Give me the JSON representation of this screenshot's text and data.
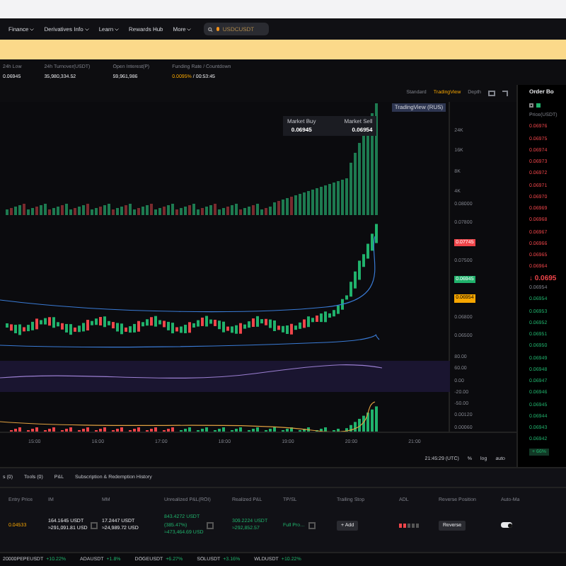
{
  "nav": {
    "items": [
      {
        "label": "Finance",
        "dropdown": true
      },
      {
        "label": "Derivatives Info",
        "dropdown": true
      },
      {
        "label": "Learn",
        "dropdown": true
      },
      {
        "label": "Rewards Hub",
        "dropdown": false
      },
      {
        "label": "More",
        "dropdown": true
      }
    ],
    "search": {
      "placeholder": "USDCUSDT"
    }
  },
  "stats": [
    {
      "label": "24h Low",
      "value": "0.06945",
      "highlight": false
    },
    {
      "label": "24h Turnover(USDT)",
      "value": "35,980,334.52",
      "highlight": false
    },
    {
      "label": "Open Interest(P)",
      "value": "59,961,986",
      "highlight": false
    },
    {
      "label": "Funding Rate / Countdown",
      "value": "0.0095%",
      "extra": "/ 00:53:45",
      "highlight": true
    }
  ],
  "chart": {
    "views": [
      {
        "label": "Standard",
        "selected": false
      },
      {
        "label": "TradingView",
        "selected": true
      },
      {
        "label": "Depth",
        "selected": false
      }
    ],
    "tv_badge": "TradingView (RUS)",
    "market_buy": {
      "label": "Market Buy",
      "price": "0.06945"
    },
    "market_sell": {
      "label": "Market Sell",
      "price": "0.06954"
    },
    "volume_labels": [
      "24K",
      "16K",
      "8K",
      "4K"
    ],
    "price_labels": [
      {
        "text": "0.08000",
        "kind": "plain"
      },
      {
        "text": "0.07800",
        "kind": "plain"
      },
      {
        "text": "0.07745",
        "kind": "sell"
      },
      {
        "text": "0.07500",
        "kind": "plain"
      },
      {
        "text": "0.06945",
        "kind": "buy"
      },
      {
        "text": "0.06954",
        "kind": "mark"
      },
      {
        "text": "0.06800",
        "kind": "plain"
      },
      {
        "text": "0.06500",
        "kind": "plain"
      }
    ],
    "osc_labels": [
      "80.00",
      "60.00",
      "0.00",
      "-20.00",
      "-50.00",
      "0.00120",
      "0.00060"
    ],
    "time_labels": [
      "15:00",
      "16:00",
      "17:00",
      "18:00",
      "19:00",
      "20:00",
      "21:00"
    ],
    "clock": "21:45:29 (UTC)",
    "options": [
      "%",
      "log",
      "auto"
    ]
  },
  "order_book": {
    "title": "Order Bo",
    "header": "Price(USDT)",
    "asks": [
      "0.06976",
      "0.06975",
      "0.06974",
      "0.06973",
      "0.06972",
      "0.06971",
      "0.06970",
      "0.06969",
      "0.06968",
      "0.06967",
      "0.06966",
      "0.06965",
      "0.06964"
    ],
    "last_price": "↓ 0.0695",
    "mark": "0.06954",
    "bids": [
      "0.06954",
      "0.06953",
      "0.06952",
      "0.06951",
      "0.06950",
      "0.06949",
      "0.06948",
      "0.06947",
      "0.06946",
      "0.06945",
      "0.06944",
      "0.06943",
      "0.06942"
    ],
    "ratio": "+ 66%"
  },
  "positions": {
    "tabs": [
      {
        "label": "s (0)",
        "selected": false
      },
      {
        "label": "Tools (0)",
        "selected": false
      },
      {
        "label": "P&L",
        "selected": false
      },
      {
        "label": "Subscription & Redemption History",
        "selected": false
      }
    ],
    "columns": [
      "Entry Price",
      "IM",
      "MM",
      "Unrealized P&L(ROI)",
      "Realized P&L",
      "TP/SL",
      "Trailing Stop",
      "ADL",
      "Reverse Position",
      "Auto-Ma"
    ],
    "row": {
      "entry": "0.04533",
      "im": [
        "164.1645 USDT",
        "≈291,091.81 USD"
      ],
      "mm": [
        "17.2447 USDT",
        "≈24,989.72 USD"
      ],
      "upnl": [
        "843.4272 USDT",
        "(385.47%)",
        "≈473,464.69 USD"
      ],
      "rpnl": [
        "309.2224 USDT",
        "≈292,852.57"
      ],
      "tpsl": "Full Pro…",
      "trailing": "+ Add",
      "reverse": "Reverse",
      "auto_margin": true
    }
  },
  "ticker": [
    {
      "symbol": "20000PEPEUSDT",
      "change": "+10.22%",
      "up": true
    },
    {
      "symbol": "ADAUSDT",
      "change": "+1.8%",
      "up": true
    },
    {
      "symbol": "DOGEUSDT",
      "change": "+6.27%",
      "up": true
    },
    {
      "symbol": "SOLUSDT",
      "change": "+3.16%",
      "up": true
    },
    {
      "symbol": "WLDUSDT",
      "change": "+10.22%",
      "up": true
    }
  ]
}
